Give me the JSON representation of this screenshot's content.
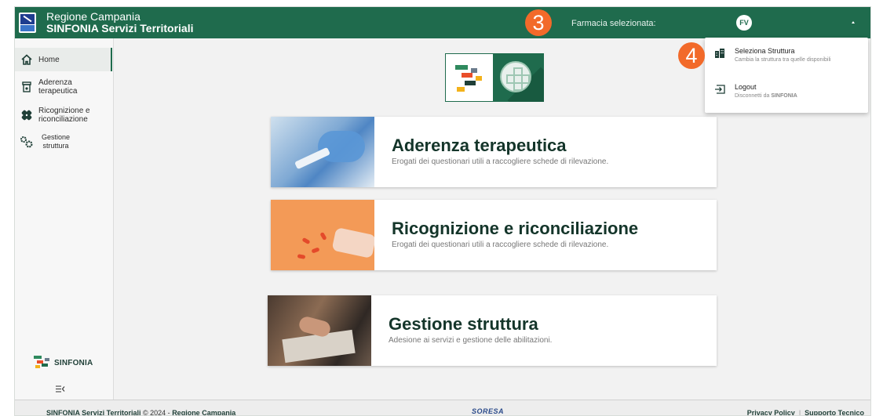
{
  "header": {
    "title_line1": "Regione Campania",
    "title_line2": "SINFONIA Servizi Territoriali",
    "pharmacy_label": "Farmacia selezionata:",
    "avatar_initials": "FV",
    "step_badge": "3"
  },
  "sidebar": {
    "items": [
      {
        "label": "Home",
        "icon": "home-icon",
        "active": true
      },
      {
        "label": "Aderenza terapeutica",
        "icon": "pill-bottle-icon"
      },
      {
        "label": "Ricognizione e riconciliazione",
        "icon": "bandage-icon"
      },
      {
        "label": "Gestione struttura",
        "icon": "gears-icon"
      }
    ],
    "brand": "SINFONIA",
    "collapse_icon": "collapse-menu-icon"
  },
  "cards": [
    {
      "title": "Aderenza terapeutica",
      "subtitle": "Erogati dei questionari utili a raccogliere schede di rilevazione."
    },
    {
      "title": "Ricognizione e riconciliazione",
      "subtitle": "Erogati dei questionari utili a raccogliere schede di rilevazione."
    },
    {
      "title": "Gestione struttura",
      "subtitle": "Adesione ai servizi e gestione delle abilitazioni."
    }
  ],
  "menu": {
    "step_badge": "4",
    "items": [
      {
        "title": "Seleziona Struttura",
        "desc": "Cambia la struttura tra quelle disponibili",
        "icon": "building-icon"
      },
      {
        "title": "Logout",
        "desc_prefix": "Disconnetti da ",
        "desc_bold": "SINFONIA",
        "icon": "logout-icon"
      }
    ]
  },
  "footer": {
    "left_app": "SINFONIA Servizi Territoriali",
    "left_mid": " © 2024 - ",
    "left_org": "Regione Campania",
    "center_logo": "SORESA",
    "privacy": "Privacy Policy",
    "separator": "|",
    "support": "Supporto Tecnico"
  },
  "colors": {
    "brand_green": "#1f6b4d",
    "badge_orange": "#f26a2a",
    "title_dark": "#14352a"
  }
}
